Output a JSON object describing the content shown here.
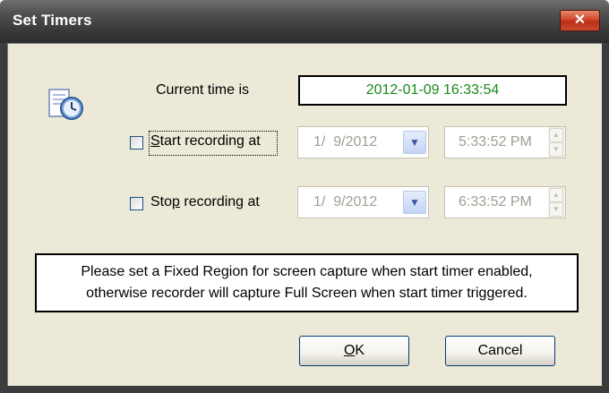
{
  "window": {
    "title": "Set Timers",
    "close_symbol": "✕"
  },
  "current_time": {
    "label": "Current time is",
    "value": "2012-01-09  16:33:54"
  },
  "start": {
    "label_pre": "",
    "label_mnemonic": "S",
    "label_post": "tart recording at",
    "checked": false,
    "date": "1/  9/2012",
    "time": "5:33:52 PM"
  },
  "stop": {
    "label_pre": "Sto",
    "label_mnemonic": "p",
    "label_post": " recording at",
    "checked": false,
    "date": "1/  9/2012",
    "time": "6:33:52 PM"
  },
  "notice": {
    "line1": "Please set a Fixed Region for screen capture when start timer enabled,",
    "line2": "otherwise recorder will capture Full Screen when start timer triggered."
  },
  "buttons": {
    "ok": "OK",
    "ok_mnemonic": "O",
    "ok_rest": "K",
    "cancel": "Cancel"
  },
  "icons": {
    "app": "timer-clock-icon",
    "dropdown": "chevron-down-icon",
    "spin_up": "spin-up-icon",
    "spin_down": "spin-down-icon"
  },
  "colors": {
    "time_text": "#1a8a1a",
    "close_button": "#c94a2c"
  }
}
